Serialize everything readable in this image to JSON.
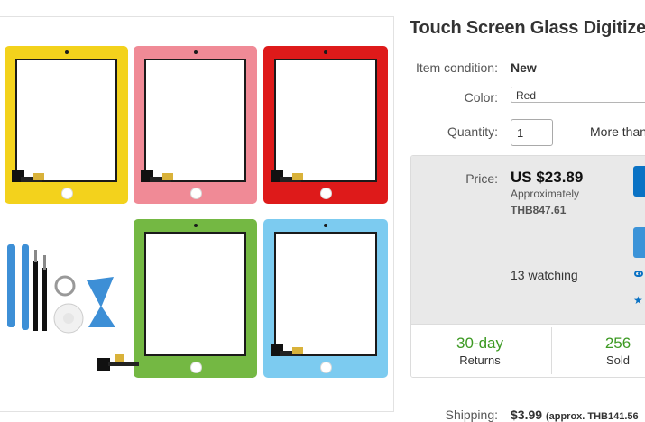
{
  "listing": {
    "title": "Touch Screen Glass Digitizer"
  },
  "gallery": {
    "tablet_colors": [
      "#f3d21c",
      "#f08a96",
      "#de1a1a",
      "#74b843",
      "#7ccbf0"
    ]
  },
  "details": {
    "condition_label": "Item condition:",
    "condition_value": "New",
    "color_label": "Color:",
    "color_value": "Red",
    "quantity_label": "Quantity:",
    "quantity_value": "1",
    "more_text": "More than"
  },
  "price": {
    "label": "Price:",
    "value": "US $23.89",
    "approx_label": "Approximately",
    "approx_value": "THB847.61",
    "watching": "13 watching"
  },
  "stats": [
    {
      "value": "30-day",
      "label": "Returns"
    },
    {
      "value": "256",
      "label": "Sold"
    }
  ],
  "shipping": {
    "label": "Shipping:",
    "value": "$3.99",
    "approx": "(approx. THB141.56"
  },
  "colors": {
    "accent_blue": "#0a72c4",
    "stat_green": "#3d9a23",
    "price_bg": "#e9e9e9"
  }
}
